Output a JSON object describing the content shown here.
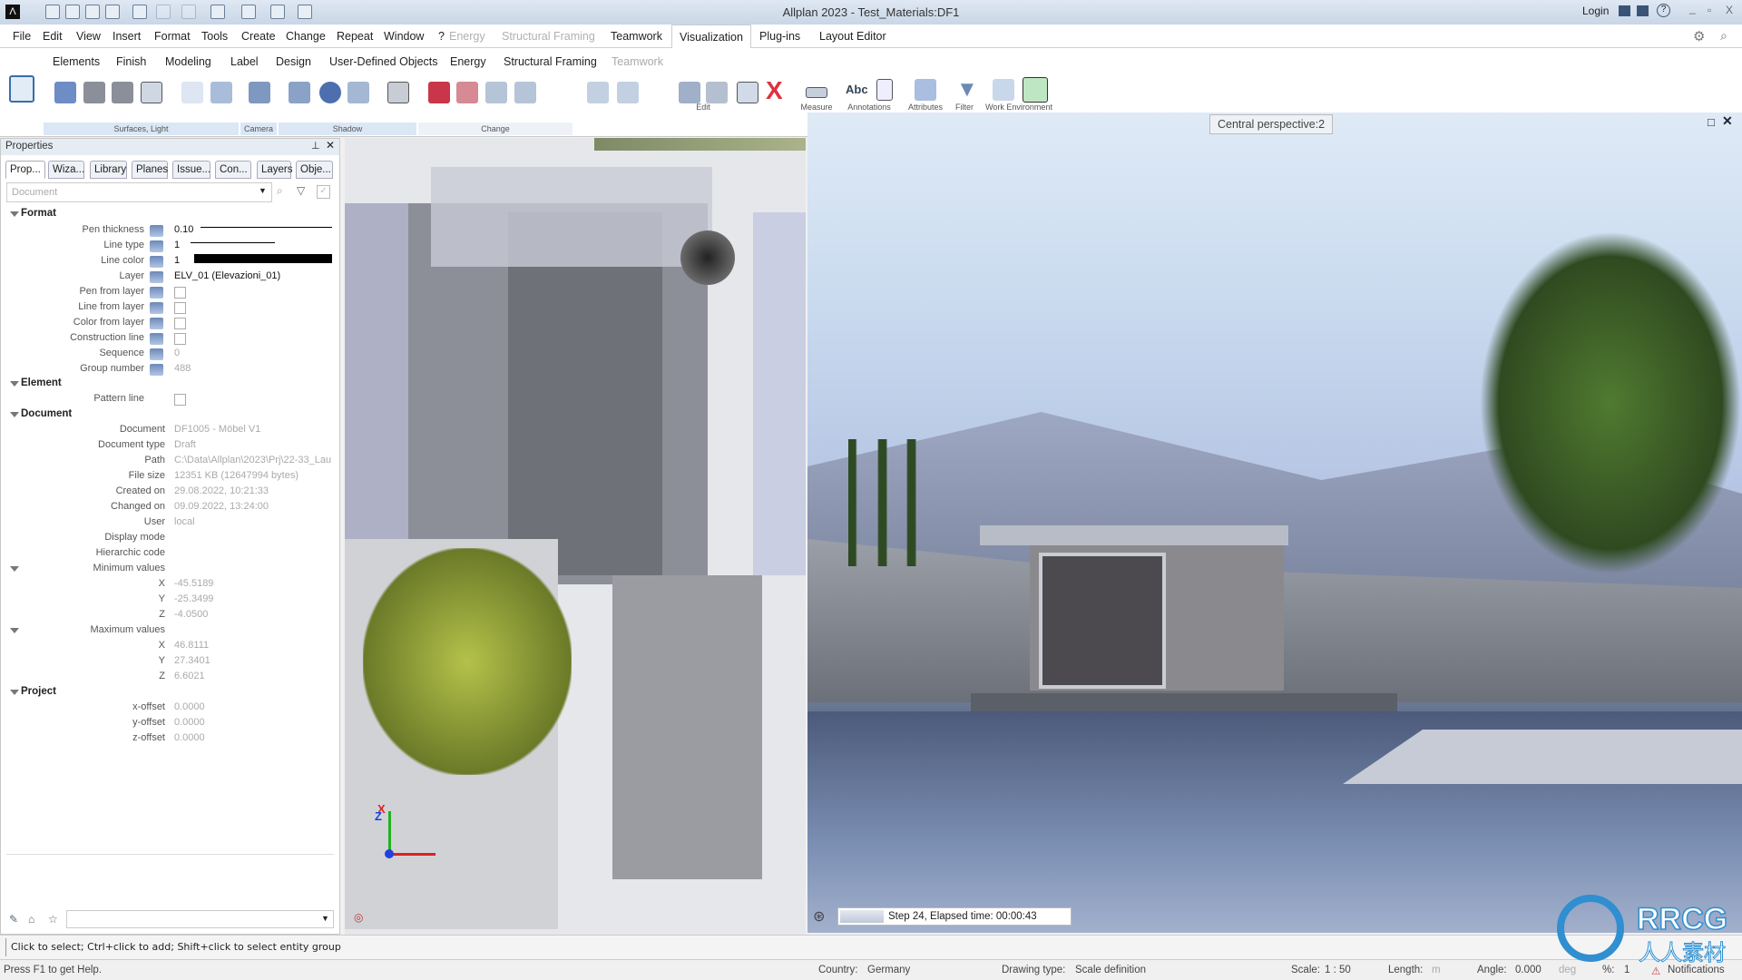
{
  "titlebar": {
    "title": "Allplan 2023 - Test_Materials:DF1",
    "login": "Login"
  },
  "menu": {
    "items": [
      "File",
      "Edit",
      "View",
      "Insert",
      "Format",
      "Tools",
      "Create",
      "Change",
      "Repeat",
      "Window",
      "?"
    ],
    "dim_tabs": [
      "Energy",
      "Structural Framing"
    ],
    "tabs": [
      "Teamwork",
      "Visualization",
      "Plug-ins",
      "Layout Editor"
    ],
    "active": "Visualization"
  },
  "ribbon": {
    "tabs": [
      "Elements",
      "Finish",
      "Modeling",
      "Label",
      "Design",
      "User-Defined Objects",
      "Energy",
      "Structural Framing",
      "Teamwork"
    ],
    "groups": [
      "Surfaces, Light",
      "Camera",
      "Shadow",
      "Change",
      "Edit",
      "Measure",
      "Annotations",
      "Attributes",
      "Filter",
      "Work Environment"
    ]
  },
  "properties": {
    "title": "Properties",
    "tabs": [
      "Prop...",
      "Wiza...",
      "Library",
      "Planes",
      "Issue...",
      "Con...",
      "Layers",
      "Obje..."
    ],
    "filter_placeholder": "Document",
    "format": {
      "heading": "Format",
      "rows": [
        {
          "label": "Pen thickness",
          "value": "0.10"
        },
        {
          "label": "Line type",
          "value": "1"
        },
        {
          "label": "Line color",
          "value": "1"
        },
        {
          "label": "Layer",
          "value": "ELV_01 (Elevazioni_01)"
        },
        {
          "label": "Pen from layer"
        },
        {
          "label": "Line from layer"
        },
        {
          "label": "Color from layer"
        },
        {
          "label": "Construction line"
        },
        {
          "label": "Sequence",
          "value": "0"
        },
        {
          "label": "Group number",
          "value": "488"
        }
      ]
    },
    "element": {
      "heading": "Element",
      "rows": [
        {
          "label": "Pattern line"
        }
      ]
    },
    "document": {
      "heading": "Document",
      "rows": [
        {
          "label": "Document",
          "value": "DF1005 - Möbel V1"
        },
        {
          "label": "Document type",
          "value": "Draft"
        },
        {
          "label": "Path",
          "value": "C:\\Data\\Allplan\\2023\\Prj\\22-33_Lau"
        },
        {
          "label": "File size",
          "value": "12351 KB (12647994 bytes)"
        },
        {
          "label": "Created on",
          "value": "29.08.2022, 10:21:33"
        },
        {
          "label": "Changed on",
          "value": "09.09.2022, 13:24:00"
        },
        {
          "label": "User",
          "value": "local"
        },
        {
          "label": "Display mode",
          "value": ""
        },
        {
          "label": "Hierarchic code",
          "value": ""
        }
      ],
      "min": {
        "label": "Minimum values",
        "x": "-45.5189",
        "y": "-25.3499",
        "z": "-4.0500"
      },
      "max": {
        "label": "Maximum values",
        "x": "46.8111",
        "y": "27.3401",
        "z": "6.6021"
      },
      "axes": [
        "X",
        "Y",
        "Z"
      ]
    },
    "project": {
      "heading": "Project",
      "rows": [
        {
          "label": "x-offset",
          "value": "0.0000"
        },
        {
          "label": "y-offset",
          "value": "0.0000"
        },
        {
          "label": "z-offset",
          "value": "0.0000"
        }
      ]
    }
  },
  "plan": {
    "axis_x": "X",
    "axis_z": "Z"
  },
  "render": {
    "view_label": "Central perspective:2",
    "progress_text": "Step 24, Elapsed time: 00:00:43"
  },
  "prompt": "Click to select; Ctrl+click to add; Shift+click to select entity group",
  "status": {
    "help": "Press F1 to get Help.",
    "country_label": "Country:",
    "country": "Germany",
    "drawing_type_label": "Drawing type:",
    "drawing_type": "Scale definition",
    "scale_label": "Scale:",
    "scale": "1 : 50",
    "length_label": "Length:",
    "length_unit": "m",
    "angle_label": "Angle:",
    "angle": "0.000",
    "angle_unit": "deg",
    "percent_label": "%:",
    "percent": "1",
    "notifications": "Notifications"
  },
  "watermark": {
    "text": "RRCG",
    "subtext": "人人素材"
  }
}
